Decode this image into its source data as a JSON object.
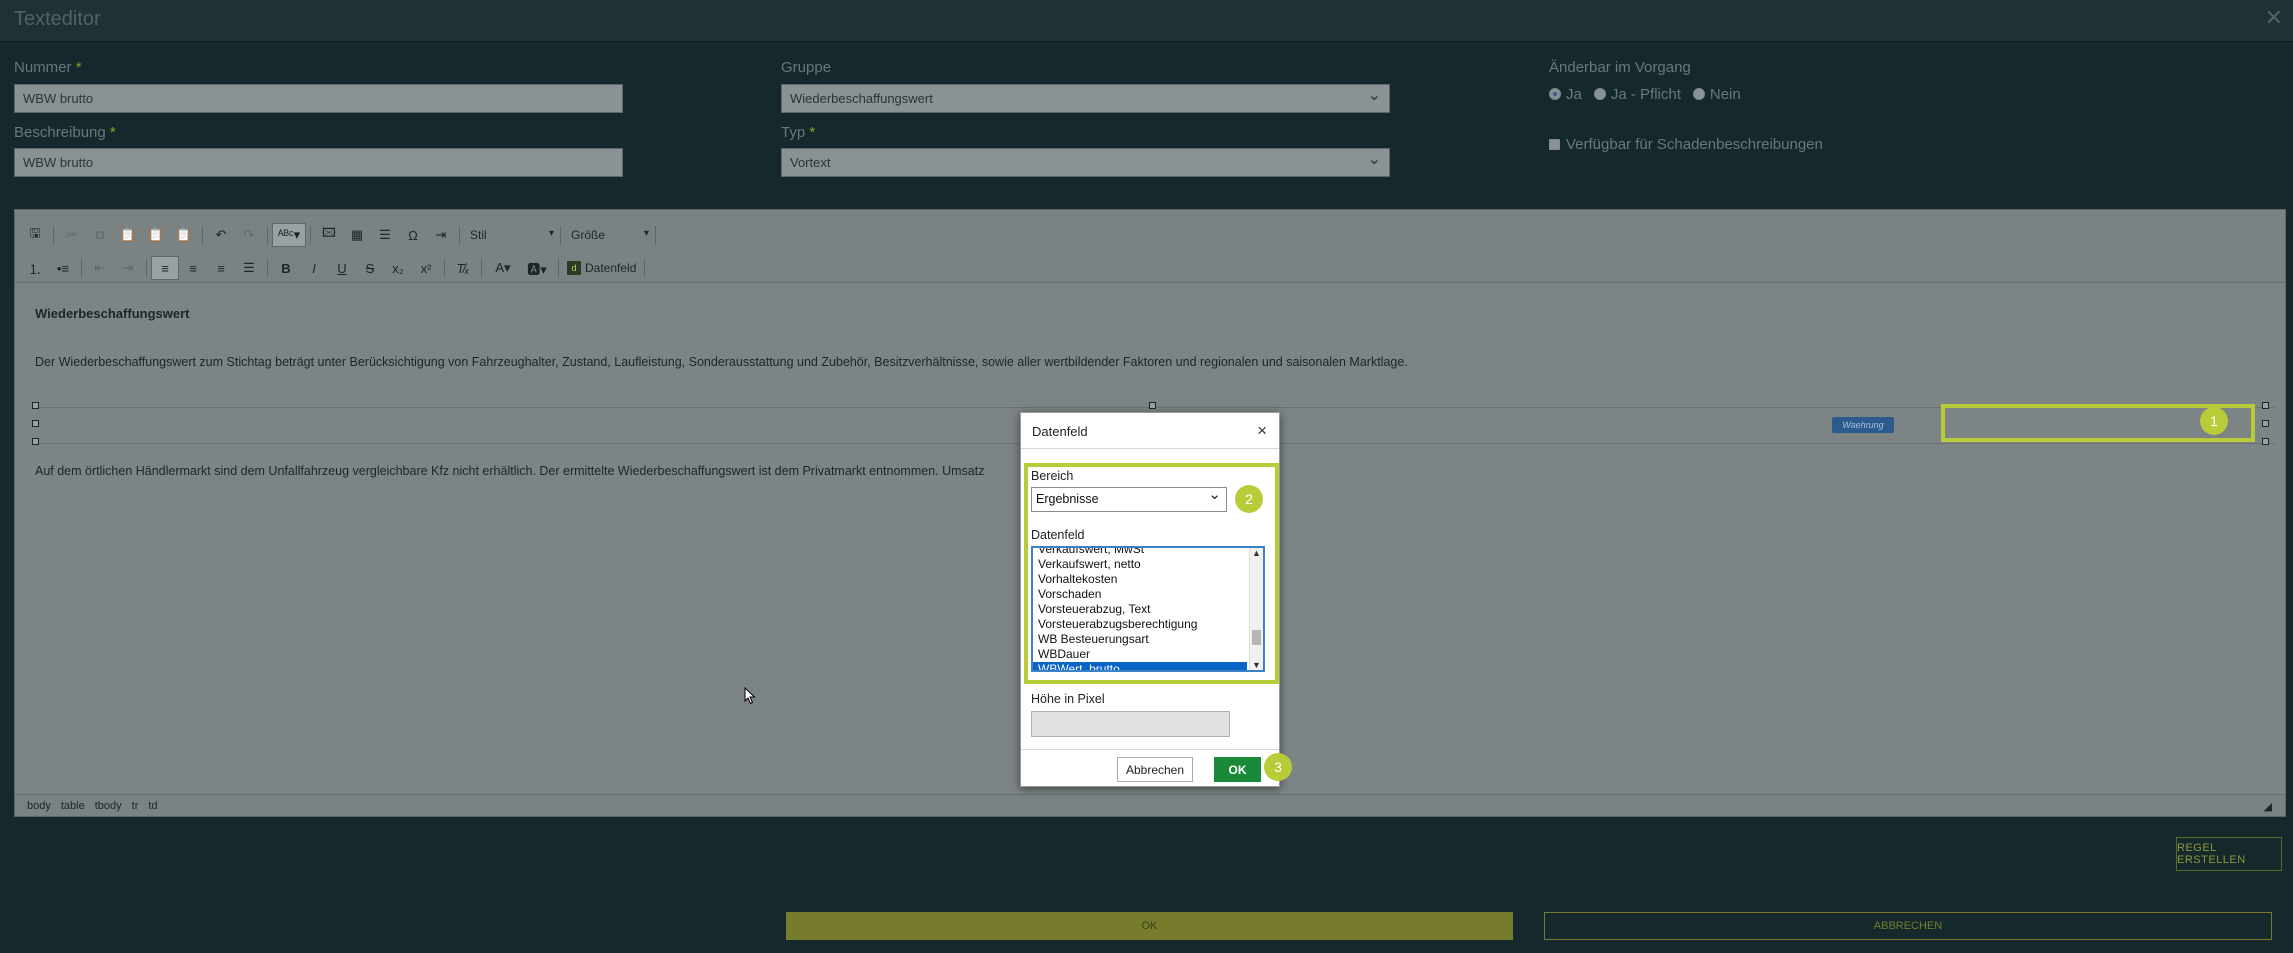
{
  "window": {
    "title": "Texteditor",
    "close_glyph": "✕"
  },
  "form": {
    "nummer": {
      "label": "Nummer",
      "required_mark": "*",
      "value": "WBW brutto"
    },
    "beschreibung": {
      "label": "Beschreibung",
      "required_mark": "*",
      "value": "WBW brutto"
    },
    "gruppe": {
      "label": "Gruppe",
      "value": "Wiederbeschaffungswert"
    },
    "typ": {
      "label": "Typ",
      "required_mark": "*",
      "value": "Vortext"
    },
    "aenderbar": {
      "label": "Änderbar im Vorgang",
      "options": [
        "Ja",
        "Ja - Pflicht",
        "Nein"
      ],
      "selected": "Ja"
    },
    "verfuegbar": {
      "label": "Verfügbar für Schadenbeschreibungen",
      "checked": false
    }
  },
  "toolbar": {
    "style_label": "Stil",
    "size_label": "Größe",
    "datenfeld_label": "Datenfeld",
    "row1_icons": [
      "save-icon",
      "cut-icon",
      "copy-icon",
      "paste-icon",
      "paste-text-icon",
      "paste-word-icon",
      "undo-icon",
      "redo-icon",
      "spellcheck-icon",
      "image-icon",
      "table-icon",
      "horizontal-line-icon",
      "special-char-icon",
      "page-break-icon"
    ],
    "row2_icons": [
      "numbered-list-icon",
      "bullet-list-icon",
      "outdent-icon",
      "indent-icon",
      "align-left-icon",
      "align-center-icon",
      "align-right-icon",
      "justify-icon",
      "bold-icon",
      "italic-icon",
      "underline-icon",
      "strikethrough-icon",
      "subscript-icon",
      "superscript-icon",
      "remove-format-icon",
      "text-color-icon",
      "background-color-icon"
    ]
  },
  "content": {
    "heading": "Wiederbeschaffungswert",
    "para1": "Der Wiederbeschaffungswert zum Stichtag beträgt unter Berücksichtigung von Fahrzeughalter, Zustand, Laufleistung, Sonderausstattung und Zubehör, Besitzverhältnisse, sowie aller wertbildender Faktoren und regionalen und saisonalen Marktlage.",
    "para2": "Auf dem örtlichen Händlermarkt sind dem Unfallfahrzeug vergleichbare Kfz nicht erhältlich. Der ermittelte Wiederbeschaffungswert ist dem Privatmarkt entnommen. Umsatz",
    "waehrung_tag": "Waehrung"
  },
  "statusbar": {
    "path": [
      "body",
      "table",
      "tbody",
      "tr",
      "td"
    ]
  },
  "markers": {
    "m1": "1",
    "m2": "2",
    "m3": "3"
  },
  "dialog": {
    "title": "Datenfeld",
    "close_glyph": "×",
    "bereich_label": "Bereich",
    "bereich_value": "Ergebnisse",
    "datenfeld_label": "Datenfeld",
    "datenfeld_items": [
      "Verkaufswert, MwSt",
      "Verkaufswert, netto",
      "Vorhaltekosten",
      "Vorschaden",
      "Vorsteuerabzug, Text",
      "Vorsteuerabzugsberechtigung",
      "WB Besteuerungsart",
      "WBDauer",
      "WBWert, brutto"
    ],
    "datenfeld_selected": "WBWert, brutto",
    "hoehe_label": "Höhe in Pixel",
    "hoehe_value": "",
    "cancel_label": "Abbrechen",
    "ok_label": "OK"
  },
  "footer": {
    "regel_label": "REGEL ERSTELLEN",
    "ok_label": "OK",
    "abbrechen_label": "ABBRECHEN"
  },
  "colors": {
    "highlight": "#b8cc3a",
    "ok_green": "#1a8a3a",
    "selection_blue": "#0a64c8"
  }
}
